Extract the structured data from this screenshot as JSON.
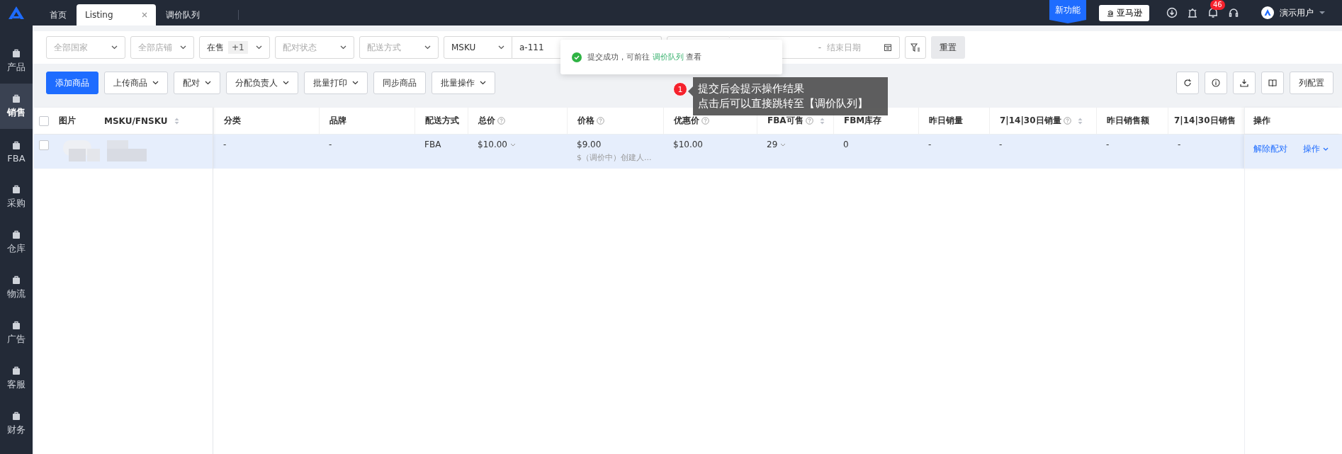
{
  "sidebar": {
    "items": [
      {
        "label": "产品",
        "selected": false
      },
      {
        "label": "销售",
        "selected": true
      },
      {
        "label": "FBA",
        "selected": false
      },
      {
        "label": "采购",
        "selected": false
      },
      {
        "label": "仓库",
        "selected": false
      },
      {
        "label": "物流",
        "selected": false
      },
      {
        "label": "广告",
        "selected": false
      },
      {
        "label": "客服",
        "selected": false
      },
      {
        "label": "财务",
        "selected": false
      }
    ]
  },
  "tabs": [
    {
      "label": "首页",
      "selected": false,
      "closable": false
    },
    {
      "label": "Listing",
      "selected": true,
      "closable": true
    },
    {
      "label": "调价队列",
      "selected": false,
      "closable": false
    }
  ],
  "header": {
    "new_feature": "新功能",
    "store_button": "亚马逊",
    "notification_count": "46",
    "user": "演示用户"
  },
  "filters": [
    {
      "kind": "select",
      "placeholder": "全部国家"
    },
    {
      "kind": "select",
      "placeholder": "全部店铺"
    },
    {
      "kind": "multi",
      "value": "在售",
      "extra": "+1"
    },
    {
      "kind": "select",
      "placeholder": "配对状态"
    },
    {
      "kind": "select",
      "placeholder": "配送方式"
    },
    {
      "kind": "search",
      "field": "MSKU",
      "value": "a-111"
    },
    {
      "kind": "blank"
    },
    {
      "kind": "daterange",
      "separator": "-",
      "placeholder": "结束日期"
    }
  ],
  "reset": "重置",
  "toolbar": {
    "buttons": [
      {
        "label": "添加商品",
        "primary": true,
        "dropdown": false
      },
      {
        "label": "上传商品",
        "primary": false,
        "dropdown": true
      },
      {
        "label": "配对",
        "primary": false,
        "dropdown": true
      },
      {
        "label": "分配负责人",
        "primary": false,
        "dropdown": true
      },
      {
        "label": "批量打印",
        "primary": false,
        "dropdown": true
      },
      {
        "label": "同步商品",
        "primary": false,
        "dropdown": false
      },
      {
        "label": "批量操作",
        "primary": false,
        "dropdown": true
      }
    ],
    "column_config": "列配置"
  },
  "table": {
    "select_all_checked": false,
    "frozen_columns": [
      {
        "label": "图片",
        "sort": false
      },
      {
        "label": "MSKU/FNSKU",
        "sort": true
      }
    ],
    "columns": [
      {
        "label": "分类",
        "help": false,
        "sort": false
      },
      {
        "label": "品牌",
        "help": false,
        "sort": false
      },
      {
        "label": "配送方式",
        "help": false,
        "sort": false
      },
      {
        "label": "总价",
        "help": true,
        "sort": false
      },
      {
        "label": "价格",
        "help": true,
        "sort": false
      },
      {
        "label": "优惠价",
        "help": true,
        "sort": false
      },
      {
        "label": "FBA可售",
        "help": true,
        "sort": true
      },
      {
        "label": "FBM库存",
        "help": false,
        "sort": false
      },
      {
        "label": "昨日销量",
        "help": false,
        "sort": false
      },
      {
        "label": "7|14|30日销量",
        "help": true,
        "sort": true
      },
      {
        "label": "昨日销售额",
        "help": false,
        "sort": false
      },
      {
        "label": "7|14|30日销售",
        "help": false,
        "sort": false
      }
    ],
    "actions_column": "操作",
    "rows": [
      {
        "checked": false,
        "cells": [
          {
            "text": "-"
          },
          {
            "text": "-"
          },
          {
            "text": "FBA"
          },
          {
            "text": "$10.00",
            "dropdown": true
          },
          {
            "text": "$9.00",
            "sub": "$（调价中）创建人..."
          },
          {
            "text": "$10.00"
          },
          {
            "text": "29",
            "dropdown": true
          },
          {
            "text": "0"
          },
          {
            "text": "-"
          },
          {
            "text": "-"
          },
          {
            "text": "-"
          },
          {
            "text": "-"
          }
        ],
        "actions": [
          "解除配对",
          "操作"
        ]
      }
    ]
  },
  "toast": {
    "text": "提交成功，可前往",
    "link": "调价队列",
    "after": "查看"
  },
  "annotation": {
    "number": "1",
    "lines": [
      "提交后会提示操作结果",
      "点击后可以直接跳转至【调价队列】"
    ]
  }
}
